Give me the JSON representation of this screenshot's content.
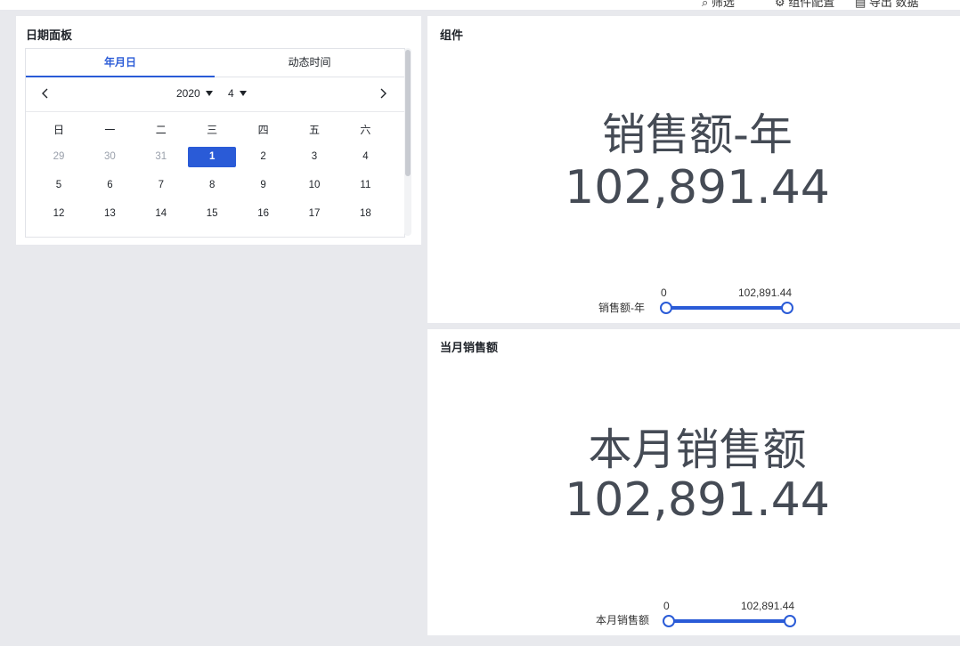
{
  "topbar": {
    "items": [
      "⌕ 筛选",
      "⚙ 组件配置",
      "▤ 导出 数据"
    ]
  },
  "date_panel": {
    "title": "日期面板",
    "tabs": [
      {
        "label": "年月日",
        "active": true
      },
      {
        "label": "动态时间",
        "active": false
      }
    ],
    "year": "2020",
    "month": "4",
    "weekdays": [
      "日",
      "一",
      "二",
      "三",
      "四",
      "五",
      "六"
    ],
    "weeks": [
      [
        {
          "d": "29",
          "muted": true
        },
        {
          "d": "30",
          "muted": true
        },
        {
          "d": "31",
          "muted": true
        },
        {
          "d": "1",
          "selected": true
        },
        {
          "d": "2"
        },
        {
          "d": "3"
        },
        {
          "d": "4"
        }
      ],
      [
        {
          "d": "5"
        },
        {
          "d": "6"
        },
        {
          "d": "7"
        },
        {
          "d": "8"
        },
        {
          "d": "9"
        },
        {
          "d": "10"
        },
        {
          "d": "11"
        }
      ],
      [
        {
          "d": "12"
        },
        {
          "d": "13"
        },
        {
          "d": "14"
        },
        {
          "d": "15"
        },
        {
          "d": "16"
        },
        {
          "d": "17"
        },
        {
          "d": "18"
        }
      ]
    ]
  },
  "kpi_year": {
    "title": "组件",
    "label": "销售额-年",
    "value": "102,891.44",
    "slider": {
      "title": "销售额-年",
      "min_label": "0",
      "max_label": "102,891.44",
      "low": 0,
      "high": 102891.44
    }
  },
  "kpi_month": {
    "title": "当月销售额",
    "label": "本月销售额",
    "value": "102,891.44",
    "slider": {
      "title": "本月销售额",
      "min_label": "0",
      "max_label": "102,891.44",
      "low": 0,
      "high": 102891.44
    }
  },
  "colors": {
    "accent": "#2a5bd7",
    "kpi_text": "#454b55",
    "background": "#e8e9ed"
  }
}
